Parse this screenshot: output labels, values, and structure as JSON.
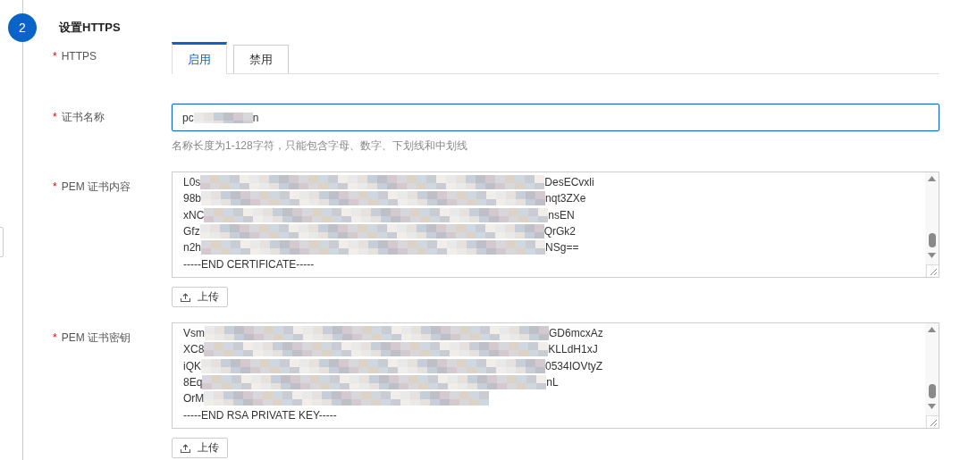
{
  "step": {
    "number": "2",
    "title": "设置HTTPS"
  },
  "fields": [
    {
      "kind": "tabs",
      "label": "HTTPS",
      "required_mark": "*",
      "tabs": [
        {
          "label": "启用",
          "selected": true
        },
        {
          "label": "禁用",
          "selected": false
        }
      ]
    },
    {
      "kind": "input",
      "label": "证书名称",
      "required_mark": "*",
      "value": {
        "start": "pc",
        "end": "n"
      },
      "focused": true,
      "hint": "名称长度为1-128字符，只能包含字母、数字、下划线和中划线"
    },
    {
      "kind": "textarea",
      "label": "PEM 证书内容",
      "required_mark": "*",
      "lines": [
        {
          "start": "L0s",
          "end": "DesECvxli"
        },
        {
          "start": "98b",
          "end": "nqt3ZXe"
        },
        {
          "start": "xNC",
          "end": "nsEN"
        },
        {
          "start": "Gfz",
          "end": "QrGk2"
        },
        {
          "start": "n2h",
          "end": "NSg=="
        },
        {
          "start": "-----END CERTIFICATE-----"
        }
      ],
      "upload": "上传"
    },
    {
      "kind": "textarea",
      "label": "PEM 证书密钥",
      "required_mark": "*",
      "lines": [
        {
          "start": "Vsm",
          "end": "GD6mcxAz"
        },
        {
          "start": "XC8",
          "end": "KLLdH1xJ"
        },
        {
          "start": "iQK",
          "end": "0534IOVtyZ"
        },
        {
          "start": "8Eq",
          "end": "nL"
        },
        {
          "start": "OrM",
          "redacted": true
        },
        {
          "start": "-----END RSA PRIVATE KEY-----"
        }
      ],
      "upload": "上传"
    }
  ]
}
